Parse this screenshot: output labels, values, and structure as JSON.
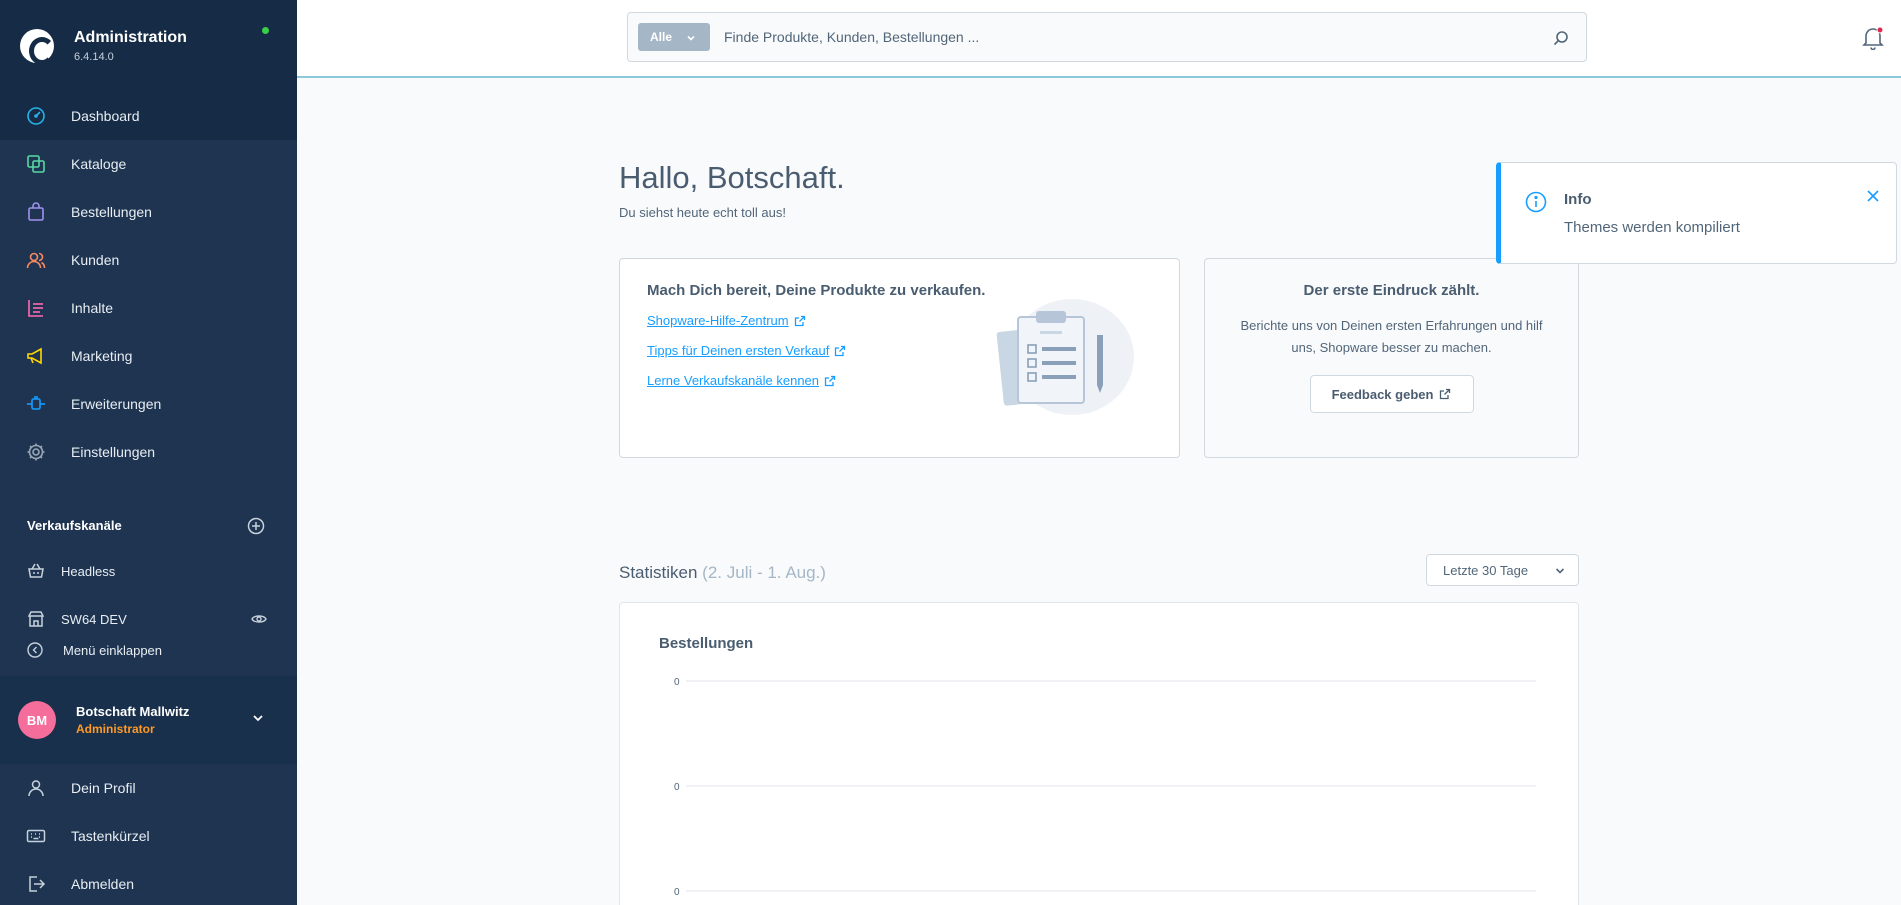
{
  "app": {
    "title": "Administration",
    "version": "6.4.14.0",
    "status_color": "#37d046",
    "icon": "shopware-logo-icon"
  },
  "colors": {
    "sidebar_bg": "#1e3450",
    "accent": "#189eff",
    "role_color": "#ff9a24",
    "avatar_bg": "#f56d9a"
  },
  "sidebar": {
    "items": [
      {
        "label": "Dashboard",
        "icon": "dashboard-icon",
        "color": "#26b2e8",
        "active": true
      },
      {
        "label": "Kataloge",
        "icon": "catalog-icon",
        "color": "#57d9a3"
      },
      {
        "label": "Bestellungen",
        "icon": "orders-bag-icon",
        "color": "#a092f0"
      },
      {
        "label": "Kunden",
        "icon": "customers-icon",
        "color": "#f88962"
      },
      {
        "label": "Inhalte",
        "icon": "content-icon",
        "color": "#ff68b4"
      },
      {
        "label": "Marketing",
        "icon": "marketing-megaphone-icon",
        "color": "#ffd700"
      },
      {
        "label": "Erweiterungen",
        "icon": "extensions-plug-icon",
        "color": "#189eff"
      },
      {
        "label": "Einstellungen",
        "icon": "settings-gear-icon",
        "color": "#9aa8b5"
      }
    ],
    "sales_channels_label": "Verkaufskanäle",
    "sales_channels": [
      {
        "label": "Headless",
        "icon": "basket-icon"
      },
      {
        "label": "SW64 DEV",
        "icon": "storefront-icon"
      }
    ],
    "collapse_label": "Menü einklappen",
    "user": {
      "initials": "BM",
      "name": "Botschaft Mallwitz",
      "role": "Administrator"
    },
    "bottom_items": [
      {
        "label": "Dein Profil",
        "icon": "profile-icon"
      },
      {
        "label": "Tastenkürzel",
        "icon": "keyboard-icon"
      },
      {
        "label": "Abmelden",
        "icon": "logout-icon"
      }
    ]
  },
  "search": {
    "type_label": "Alle",
    "placeholder": "Finde Produkte, Kunden, Bestellungen ..."
  },
  "dashboard": {
    "greeting": "Hallo, Botschaft.",
    "subgreeting": "Du siehst heute echt toll aus!",
    "getting_started": {
      "title": "Mach Dich bereit, Deine Produkte zu verkaufen.",
      "links": [
        "Shopware-Hilfe-Zentrum",
        "Tipps für Deinen ersten Verkauf",
        "Lerne Verkaufskanäle kennen"
      ]
    },
    "feedback": {
      "title": "Der erste Eindruck zählt.",
      "text": "Berichte uns von Deinen ersten Erfahrungen und hilf uns, Shopware besser zu machen.",
      "button": "Feedback geben"
    },
    "stats": {
      "title": "Statistiken",
      "range": "(2. Juli - 1. Aug.)",
      "range_select": "Letzte 30 Tage",
      "card_title": "Bestellungen"
    }
  },
  "chart_data": {
    "type": "line",
    "title": "Bestellungen",
    "y_ticks": [
      "0",
      "0",
      "0"
    ],
    "series": [],
    "grid": true
  },
  "toast": {
    "title": "Info",
    "message": "Themes werden kompiliert"
  }
}
